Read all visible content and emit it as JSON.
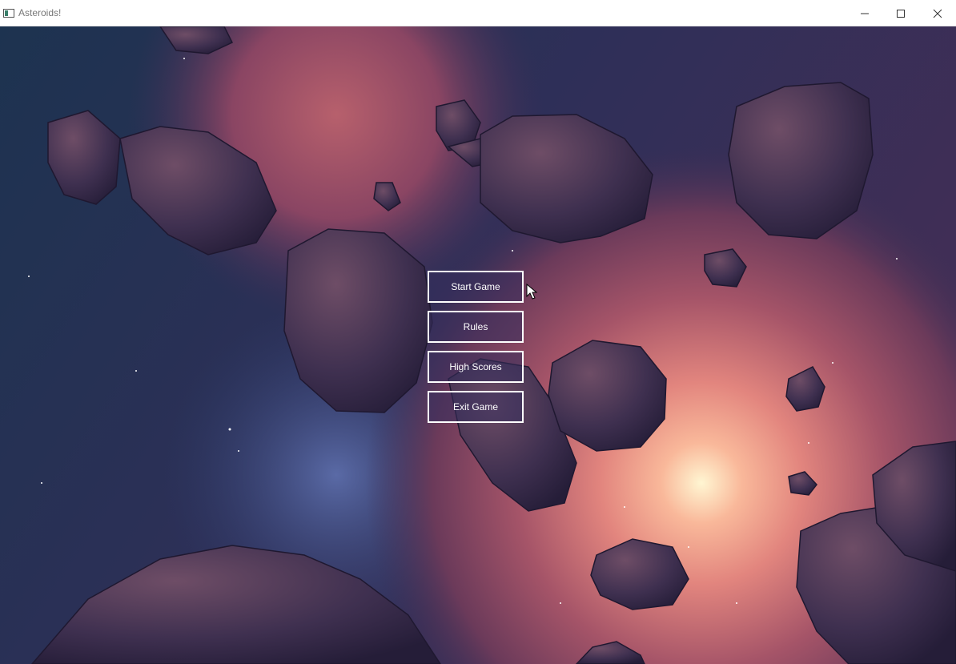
{
  "window": {
    "title": "Asteroids!",
    "controls": [
      "minimize-icon",
      "maximize-icon",
      "close-icon"
    ]
  },
  "menu": {
    "start_label": "Start Game",
    "rules_label": "Rules",
    "high_scores_label": "High Scores",
    "exit_label": "Exit Game"
  },
  "colors": {
    "space_dark": "#1b2a4a",
    "nebula_pink": "#c8647a",
    "star_core": "#fff6d2",
    "asteroid": "#4a3856",
    "button_border": "#ffffff"
  }
}
